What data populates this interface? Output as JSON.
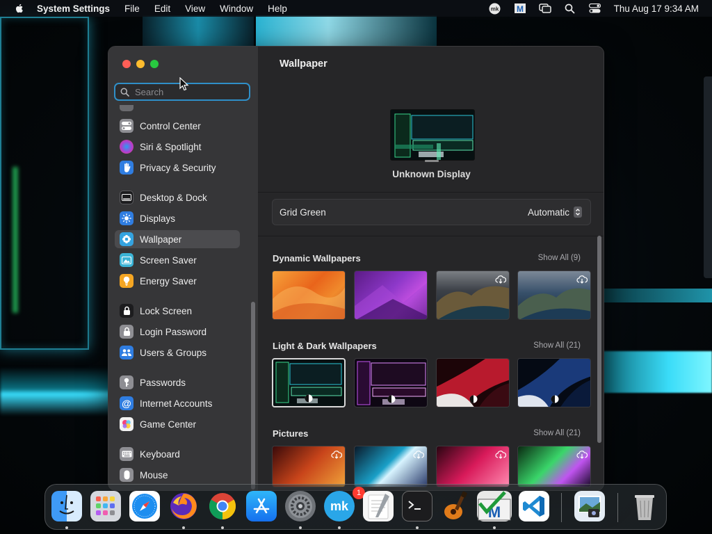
{
  "menubar": {
    "app_name": "System Settings",
    "items": [
      "File",
      "Edit",
      "View",
      "Window",
      "Help"
    ],
    "clock": "Thu Aug 17  9:34 AM",
    "status_icons": [
      "mk-icon",
      "m-app-icon",
      "screen-mirroring-icon",
      "spotlight-search-icon",
      "control-center-icon"
    ]
  },
  "sidebar": {
    "search_placeholder": "Search",
    "items": [
      {
        "label": "Control Center",
        "icon": "control-center-icon",
        "color": "#8e8e93"
      },
      {
        "label": "Siri & Spotlight",
        "icon": "siri-icon",
        "color": "#c0397a"
      },
      {
        "label": "Privacy & Security",
        "icon": "hand-icon",
        "color": "#2f7de1"
      },
      {
        "label": "Desktop & Dock",
        "icon": "desktop-dock-icon",
        "color": "#1c1c1e"
      },
      {
        "label": "Displays",
        "icon": "sun-icon",
        "color": "#2f7de1"
      },
      {
        "label": "Wallpaper",
        "icon": "wallpaper-icon",
        "color": "#34a3e0"
      },
      {
        "label": "Screen Saver",
        "icon": "screen-saver-icon",
        "color": "#3cb4d6"
      },
      {
        "label": "Energy Saver",
        "icon": "bulb-icon",
        "color": "#f5a623"
      },
      {
        "label": "Lock Screen",
        "icon": "lock-icon",
        "color": "#1c1c1e"
      },
      {
        "label": "Login Password",
        "icon": "padlock-icon",
        "color": "#8e8e93"
      },
      {
        "label": "Users & Groups",
        "icon": "users-icon",
        "color": "#2f7de1"
      },
      {
        "label": "Passwords",
        "icon": "key-icon",
        "color": "#8e8e93"
      },
      {
        "label": "Internet Accounts",
        "icon": "at-icon",
        "color": "#2f7de1"
      },
      {
        "label": "Game Center",
        "icon": "game-center-icon",
        "color": "#f2f2f2"
      },
      {
        "label": "Keyboard",
        "icon": "keyboard-icon",
        "color": "#8e8e93"
      },
      {
        "label": "Mouse",
        "icon": "mouse-icon",
        "color": "#8e8e93"
      }
    ],
    "active": "Wallpaper"
  },
  "main": {
    "title": "Wallpaper",
    "display_name": "Unknown Display",
    "current_wallpaper": "Grid Green",
    "mode": "Automatic",
    "sections": [
      {
        "title": "Dynamic Wallpapers",
        "show_all": "Show All (9)"
      },
      {
        "title": "Light & Dark Wallpapers",
        "show_all": "Show All (21)"
      },
      {
        "title": "Pictures",
        "show_all": "Show All (21)"
      }
    ]
  },
  "dock": {
    "apps": [
      "Finder",
      "Launchpad",
      "Safari",
      "Firefox",
      "Chrome",
      "App Store",
      "System Settings",
      "mk",
      "TextEdit",
      "Terminal",
      "GarageBand",
      "Monitor",
      "Visual Studio Code",
      "Preview",
      "Trash"
    ],
    "settings_badge": "1"
  },
  "colors": {
    "accent": "#2f8fc8",
    "close": "#ff5f57",
    "minimize": "#febc2e",
    "maximize": "#28c840"
  }
}
